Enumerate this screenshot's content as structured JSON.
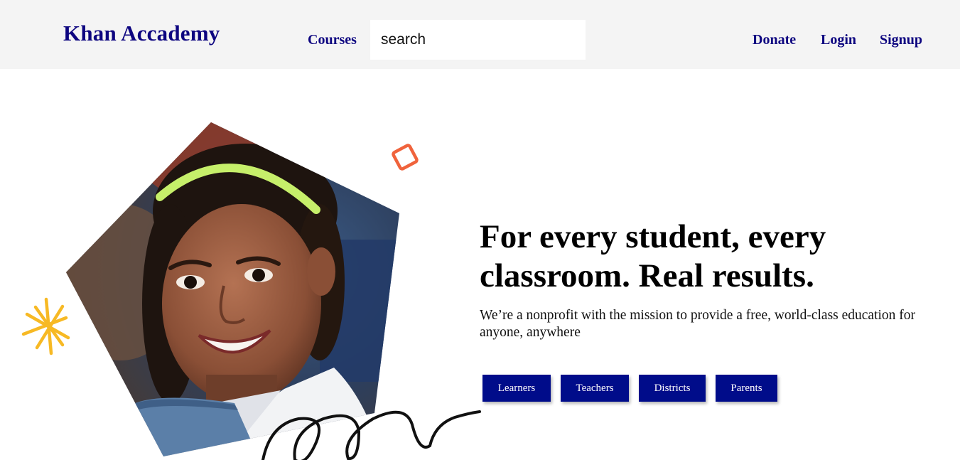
{
  "header": {
    "brand": "Khan Accademy",
    "nav": {
      "courses": "Courses",
      "donate": "Donate",
      "login": "Login",
      "signup": "Signup"
    },
    "search": {
      "placeholder": "search",
      "value": ""
    }
  },
  "hero": {
    "headline": "For every student, every classroom. Real results.",
    "tagline": "We’re a nonprofit with the mission to provide a free, world-class education for anyone, anywhere",
    "buttons": {
      "learners": "Learners",
      "teachers": "Teachers",
      "districts": "Districts",
      "parents": "Parents"
    },
    "image": {
      "subject": "smiling student portrait in pentagon frame",
      "decorations": [
        "orange-square-doodle",
        "yellow-star-doodle",
        "black-squiggle-doodle"
      ]
    }
  },
  "colors": {
    "brand_navy": "#0d0580",
    "button_navy": "#000c8a",
    "header_bg": "#f4f4f4",
    "doodle_orange": "#f0633c",
    "doodle_yellow": "#f7b924"
  }
}
